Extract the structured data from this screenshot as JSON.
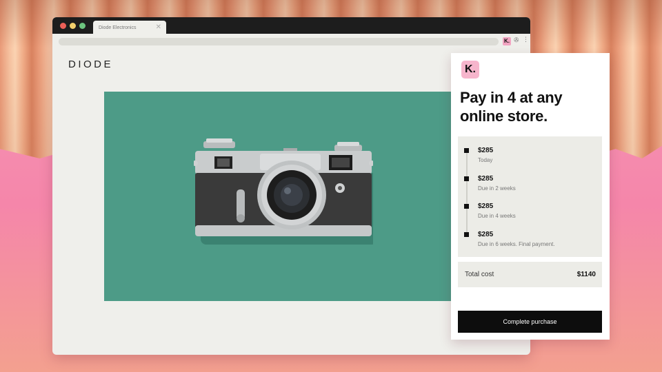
{
  "browser": {
    "tab_title": "Diode Electronics",
    "tab_close": "✕",
    "extensions": {
      "klarna_label": "K.",
      "puzzle_glyph": "✇",
      "menu_glyph": "⋮"
    }
  },
  "store": {
    "logo": "DIODE"
  },
  "klarna_panel": {
    "badge": "K.",
    "headline": "Pay in 4 at any online store.",
    "installments": [
      {
        "amount": "$285",
        "due": "Today"
      },
      {
        "amount": "$285",
        "due": "Due in 2 weeks"
      },
      {
        "amount": "$285",
        "due": "Due in 4 weeks"
      },
      {
        "amount": "$285",
        "due": "Due in 6 weeks. Final payment."
      }
    ],
    "total_label": "Total cost",
    "total_value": "$1140",
    "cta_label": "Complete purchase"
  },
  "colors": {
    "hero_background": "#4d9b87",
    "klarna_pink": "#f6b5cc",
    "cta_background": "#0d0d0d"
  },
  "icons": [
    "close-icon",
    "klarna-extension-icon",
    "puzzle-icon",
    "kebab-menu-icon",
    "klarna-logo-icon",
    "camera-image"
  ]
}
